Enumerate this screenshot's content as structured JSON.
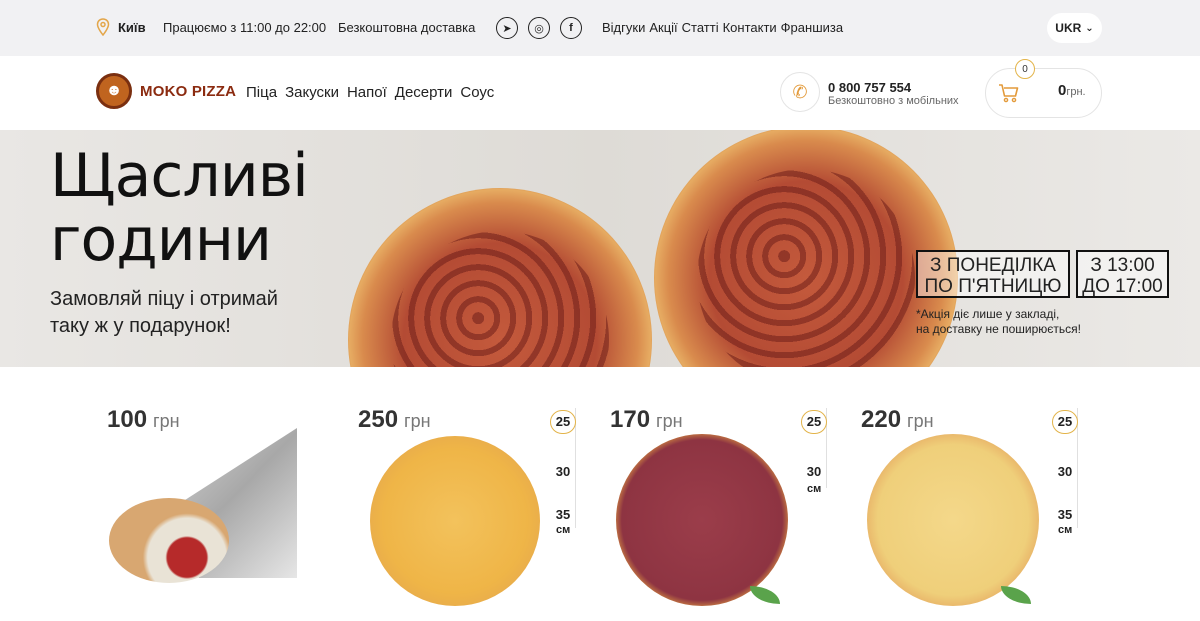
{
  "topbar": {
    "city": "Київ",
    "hours": "Працюємо з 11:00 до 22:00",
    "delivery": "Безкоштовна доставка",
    "social": [
      "telegram-icon",
      "instagram-icon",
      "facebook-icon"
    ],
    "links": [
      "Відгуки",
      "Акції",
      "Статті",
      "Контакти",
      "Франшиза"
    ],
    "lang": "UKR"
  },
  "header": {
    "logo": "MOKO PIZZA",
    "nav": [
      "Піца",
      "Закуски",
      "Напої",
      "Десерти",
      "Соус"
    ],
    "phone": "0 800 757 554",
    "phone_sub": "Безкоштовно з мобільних",
    "cart_count": "0",
    "cart_sum": "0",
    "cart_cur": "грн."
  },
  "banner": {
    "title": "Щасливі\nгодини",
    "subtitle": "Замовляй піцу і отримай\nтаку ж у подарунок!",
    "days": "З ПОНЕДІЛКА\nПО П'ЯТНИЦЮ",
    "time": "З 13:00\nДО 17:00",
    "note": "*Акція діє лише у закладі,\nна доставку не поширюється!"
  },
  "products": [
    {
      "price": "100",
      "currency": "грн",
      "type": "wrap"
    },
    {
      "price": "250",
      "currency": "грн",
      "sizes": [
        "25",
        "30",
        "35"
      ],
      "unit": "см",
      "selected": "25"
    },
    {
      "price": "170",
      "currency": "грн",
      "sizes": [
        "25",
        "30"
      ],
      "unit": "см",
      "selected": "25"
    },
    {
      "price": "220",
      "currency": "грн",
      "sizes": [
        "25",
        "30",
        "35"
      ],
      "unit": "см",
      "selected": "25"
    }
  ],
  "colors": {
    "accent": "#e39a3a",
    "brand": "#8b2b10",
    "topbar_bg": "#f1f1f3"
  }
}
